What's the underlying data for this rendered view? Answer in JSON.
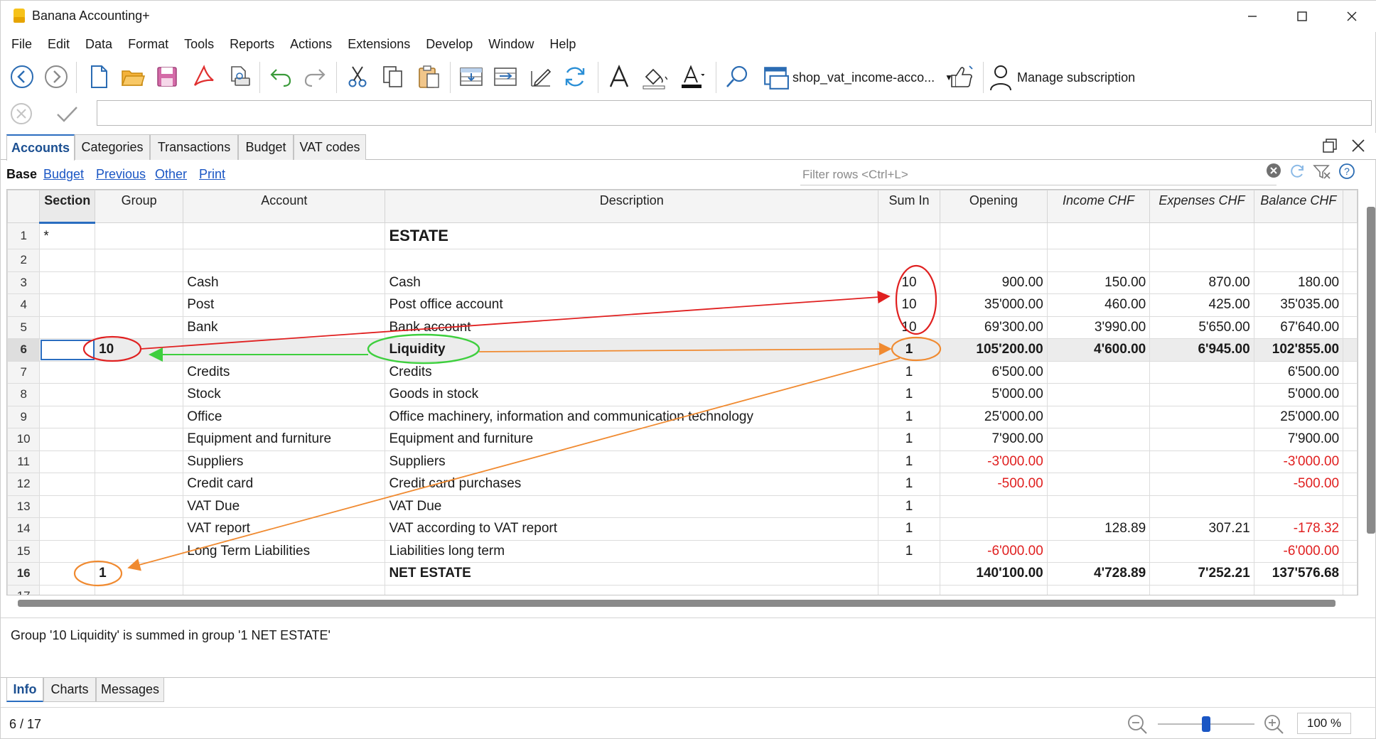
{
  "window": {
    "title": "Banana Accounting+"
  },
  "menu": [
    "File",
    "Edit",
    "Data",
    "Format",
    "Tools",
    "Reports",
    "Actions",
    "Extensions",
    "Develop",
    "Window",
    "Help"
  ],
  "toolbar": {
    "file_name": "shop_vat_income-acco...",
    "subscription_label": "Manage subscription"
  },
  "tabs": [
    "Accounts",
    "Categories",
    "Transactions",
    "Budget",
    "VAT codes"
  ],
  "views": {
    "base": "Base",
    "links": [
      "Budget",
      "Previous",
      "Other",
      "Print"
    ]
  },
  "filter": {
    "placeholder": "Filter rows <Ctrl+L>"
  },
  "table": {
    "columns": [
      "Section",
      "Group",
      "Account",
      "Description",
      "Sum In",
      "Opening",
      "Income CHF",
      "Expenses CHF",
      "Balance CHF"
    ],
    "rows": [
      {
        "n": "1",
        "section": "*",
        "group": "",
        "account": "",
        "description": "ESTATE",
        "sumin": "",
        "opening": "",
        "income": "",
        "expenses": "",
        "balance": ""
      },
      {
        "n": "2",
        "section": "",
        "group": "",
        "account": "",
        "description": "",
        "sumin": "",
        "opening": "",
        "income": "",
        "expenses": "",
        "balance": ""
      },
      {
        "n": "3",
        "section": "",
        "group": "",
        "account": "Cash",
        "description": "Cash",
        "sumin": "10",
        "opening": "900.00",
        "income": "150.00",
        "expenses": "870.00",
        "balance": "180.00"
      },
      {
        "n": "4",
        "section": "",
        "group": "",
        "account": "Post",
        "description": "Post office account",
        "sumin": "10",
        "opening": "35'000.00",
        "income": "460.00",
        "expenses": "425.00",
        "balance": "35'035.00"
      },
      {
        "n": "5",
        "section": "",
        "group": "",
        "account": "Bank",
        "description": "Bank account",
        "sumin": "10",
        "opening": "69'300.00",
        "income": "3'990.00",
        "expenses": "5'650.00",
        "balance": "67'640.00"
      },
      {
        "n": "6",
        "section": "",
        "group": "10",
        "account": "",
        "description": "Liquidity",
        "sumin": "1",
        "opening": "105'200.00",
        "income": "4'600.00",
        "expenses": "6'945.00",
        "balance": "102'855.00"
      },
      {
        "n": "7",
        "section": "",
        "group": "",
        "account": "Credits",
        "description": "Credits",
        "sumin": "1",
        "opening": "6'500.00",
        "income": "",
        "expenses": "",
        "balance": "6'500.00"
      },
      {
        "n": "8",
        "section": "",
        "group": "",
        "account": "Stock",
        "description": "Goods in stock",
        "sumin": "1",
        "opening": "5'000.00",
        "income": "",
        "expenses": "",
        "balance": "5'000.00"
      },
      {
        "n": "9",
        "section": "",
        "group": "",
        "account": "Office",
        "description": "Office machinery, information and communication technology",
        "sumin": "1",
        "opening": "25'000.00",
        "income": "",
        "expenses": "",
        "balance": "25'000.00"
      },
      {
        "n": "10",
        "section": "",
        "group": "",
        "account": "Equipment and furniture",
        "description": "Equipment and furniture",
        "sumin": "1",
        "opening": "7'900.00",
        "income": "",
        "expenses": "",
        "balance": "7'900.00"
      },
      {
        "n": "11",
        "section": "",
        "group": "",
        "account": "Suppliers",
        "description": "Suppliers",
        "sumin": "1",
        "opening": "-3'000.00",
        "income": "",
        "expenses": "",
        "balance": "-3'000.00"
      },
      {
        "n": "12",
        "section": "",
        "group": "",
        "account": "Credit card",
        "description": "Credit card purchases",
        "sumin": "1",
        "opening": "-500.00",
        "income": "",
        "expenses": "",
        "balance": "-500.00"
      },
      {
        "n": "13",
        "section": "",
        "group": "",
        "account": "VAT Due",
        "description": "VAT Due",
        "sumin": "1",
        "opening": "",
        "income": "",
        "expenses": "",
        "balance": ""
      },
      {
        "n": "14",
        "section": "",
        "group": "",
        "account": "VAT report",
        "description": "VAT according to VAT report",
        "sumin": "1",
        "opening": "",
        "income": "128.89",
        "expenses": "307.21",
        "balance": "-178.32"
      },
      {
        "n": "15",
        "section": "",
        "group": "",
        "account": "Long Term Liabilities",
        "description": "Liabilities long term",
        "sumin": "1",
        "opening": "-6'000.00",
        "income": "",
        "expenses": "",
        "balance": "-6'000.00"
      },
      {
        "n": "16",
        "section": "",
        "group": "1",
        "account": "",
        "description": "NET ESTATE",
        "sumin": "",
        "opening": "140'100.00",
        "income": "4'728.89",
        "expenses": "7'252.21",
        "balance": "137'576.68"
      },
      {
        "n": "17",
        "section": "",
        "group": "",
        "account": "",
        "description": "",
        "sumin": "",
        "opening": "",
        "income": "",
        "expenses": "",
        "balance": ""
      }
    ]
  },
  "info": {
    "message": "Group '10 Liquidity' is summed in group '1 NET ESTATE'"
  },
  "bottom_tabs": [
    "Info",
    "Charts",
    "Messages"
  ],
  "status": {
    "position": "6 / 17",
    "zoom": "100 %",
    "zoom_level_pct": 100
  },
  "colors": {
    "accent": "#2a6dc0",
    "negative": "#e02020",
    "annot_red": "#e02020",
    "annot_green": "#3ecf3e",
    "annot_orange": "#f08a30"
  }
}
